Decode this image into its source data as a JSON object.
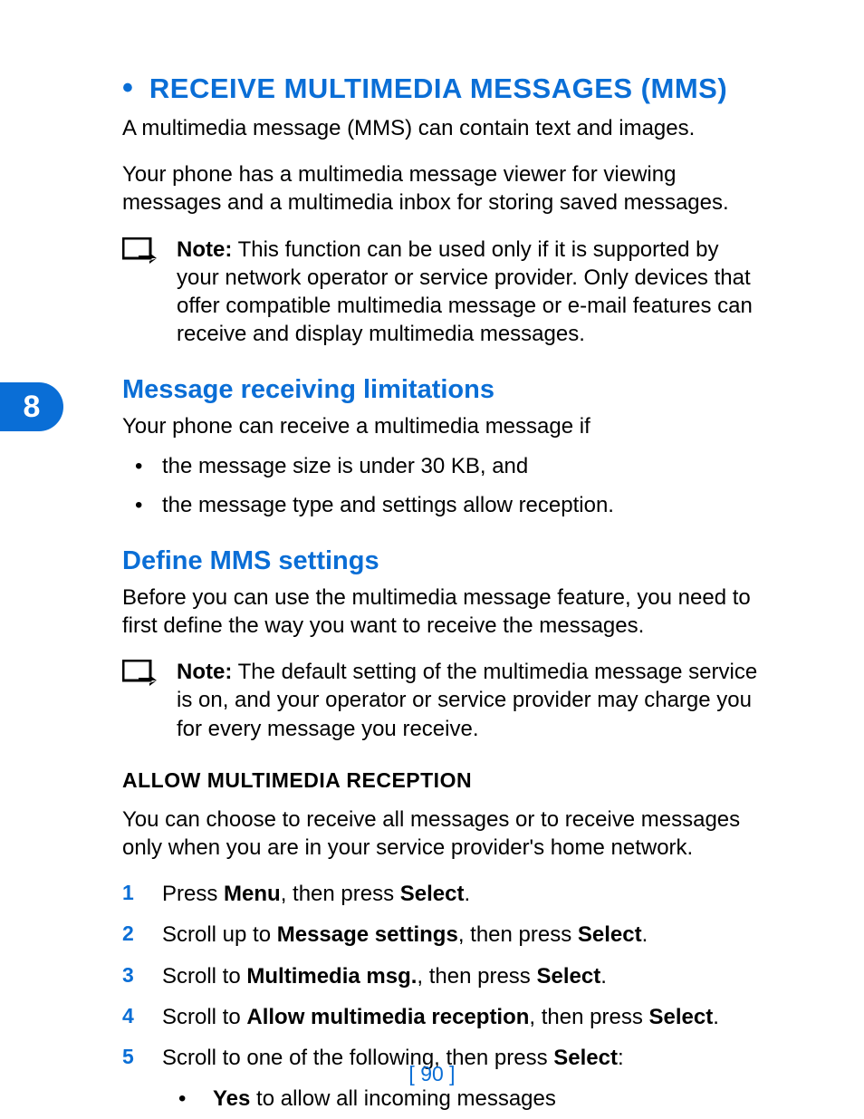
{
  "colors": {
    "accent": "#0a6ed6"
  },
  "chapter": {
    "number": "8"
  },
  "section": {
    "bullet": "•",
    "title": "RECEIVE MULTIMEDIA MESSAGES (MMS)",
    "intro_p1": "A multimedia message (MMS) can contain text and images.",
    "intro_p2": "Your phone has a multimedia message viewer for viewing messages and a multimedia inbox for storing saved messages.",
    "note1": {
      "label": "Note:",
      "text": "  This function can be used only if it is supported by your network operator or service provider. Only devices that offer compatible multimedia message or e-mail features can receive and display multimedia messages."
    }
  },
  "limitations": {
    "heading": "Message receiving limitations",
    "intro": "Your phone can receive a multimedia message if",
    "items": [
      "the message size is under 30 KB, and",
      "the message type and settings allow reception."
    ]
  },
  "define": {
    "heading": "Define MMS settings",
    "intro": "Before you can use the multimedia message feature, you need to first define the way you want to receive the messages.",
    "note2": {
      "label": "Note:",
      "text": " The default setting of the multimedia message service is on, and your operator or service provider may charge you for every message you receive."
    },
    "sub_heading": "ALLOW MULTIMEDIA RECEPTION",
    "sub_intro": "You can choose to receive all messages or to receive messages only when you are in your service provider's home network.",
    "steps": [
      {
        "n": "1",
        "parts": [
          "Press ",
          "Menu",
          ", then press ",
          "Select",
          "."
        ]
      },
      {
        "n": "2",
        "parts": [
          "Scroll up to ",
          "Message settings",
          ", then press ",
          "Select",
          "."
        ]
      },
      {
        "n": "3",
        "parts": [
          "Scroll to ",
          "Multimedia msg.",
          ", then press ",
          "Select",
          "."
        ]
      },
      {
        "n": "4",
        "parts": [
          "Scroll to ",
          "Allow multimedia reception",
          ", then press ",
          "Select",
          "."
        ]
      },
      {
        "n": "5",
        "parts": [
          "Scroll to one of the following, then press ",
          "Select",
          ":"
        ],
        "sub": [
          {
            "parts": [
              "Yes",
              " to allow all incoming messages"
            ]
          }
        ]
      }
    ]
  },
  "page_number": {
    "open": "[ ",
    "num": "90",
    "close": " ]"
  }
}
